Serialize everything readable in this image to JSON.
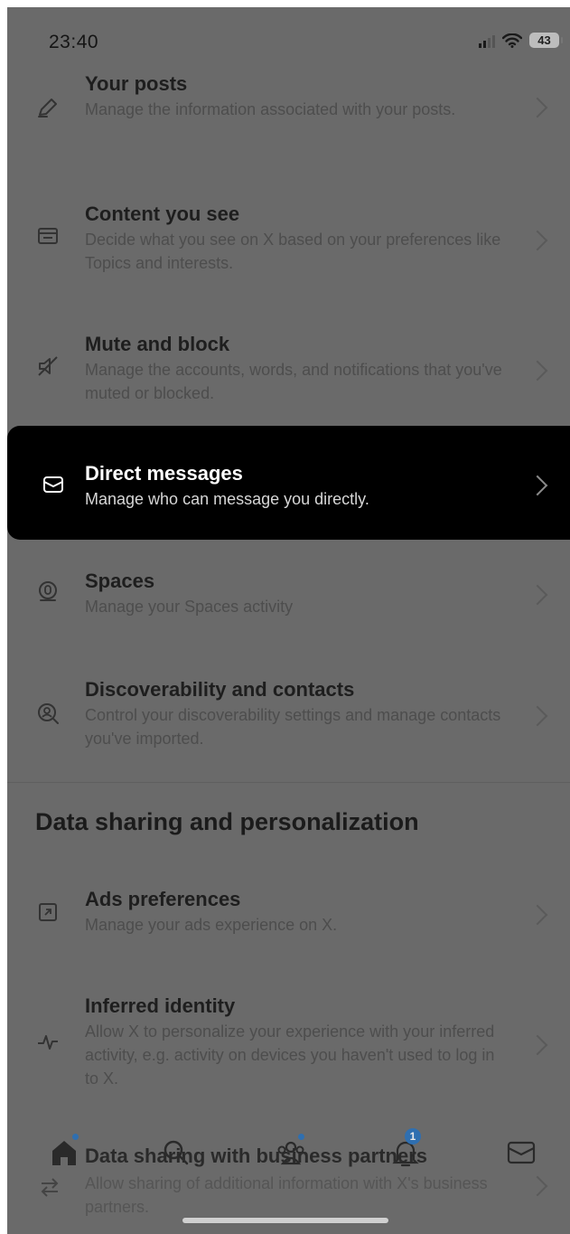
{
  "status_bar": {
    "time": "23:40",
    "battery": "43"
  },
  "settings": [
    {
      "title": "Your posts",
      "description": "Manage the information associated with your posts.",
      "icon": "pencil-icon"
    },
    {
      "title": "Content you see",
      "description": "Decide what you see on X based on your preferences like Topics and interests.",
      "icon": "content-card-icon"
    },
    {
      "title": "Mute and block",
      "description": "Manage the accounts, words, and notifications that you've muted or blocked.",
      "icon": "muted-speaker-icon"
    },
    {
      "title": "Direct messages",
      "description": "Manage who can message you directly.",
      "icon": "envelope-icon"
    },
    {
      "title": "Spaces",
      "description": "Manage your Spaces activity",
      "icon": "microphone-icon"
    },
    {
      "title": "Discoverability and contacts",
      "description": "Control your discoverability settings and manage contacts you've imported.",
      "icon": "search-person-icon"
    }
  ],
  "section": {
    "title": "Data sharing and personalization"
  },
  "data_settings": [
    {
      "title": "Ads preferences",
      "description": "Manage your ads experience on X.",
      "icon": "ad-arrow-icon"
    },
    {
      "title": "Inferred identity",
      "description": "Allow X to personalize your experience with your inferred activity, e.g. activity on devices you haven't used to log in to X.",
      "icon": "pulse-icon"
    },
    {
      "title": "Data sharing with business partners",
      "description": "Allow sharing of additional information with X's business partners.",
      "icon": "swap-arrows-icon"
    }
  ],
  "tab_bar": {
    "tabs": [
      "home-icon",
      "search-icon",
      "communities-icon",
      "notifications-icon",
      "messages-icon"
    ],
    "notification_badge": "1"
  },
  "colors": {
    "overlay": "#6a6a6a",
    "highlight": "#000000",
    "accent": "#2f6fb0"
  }
}
